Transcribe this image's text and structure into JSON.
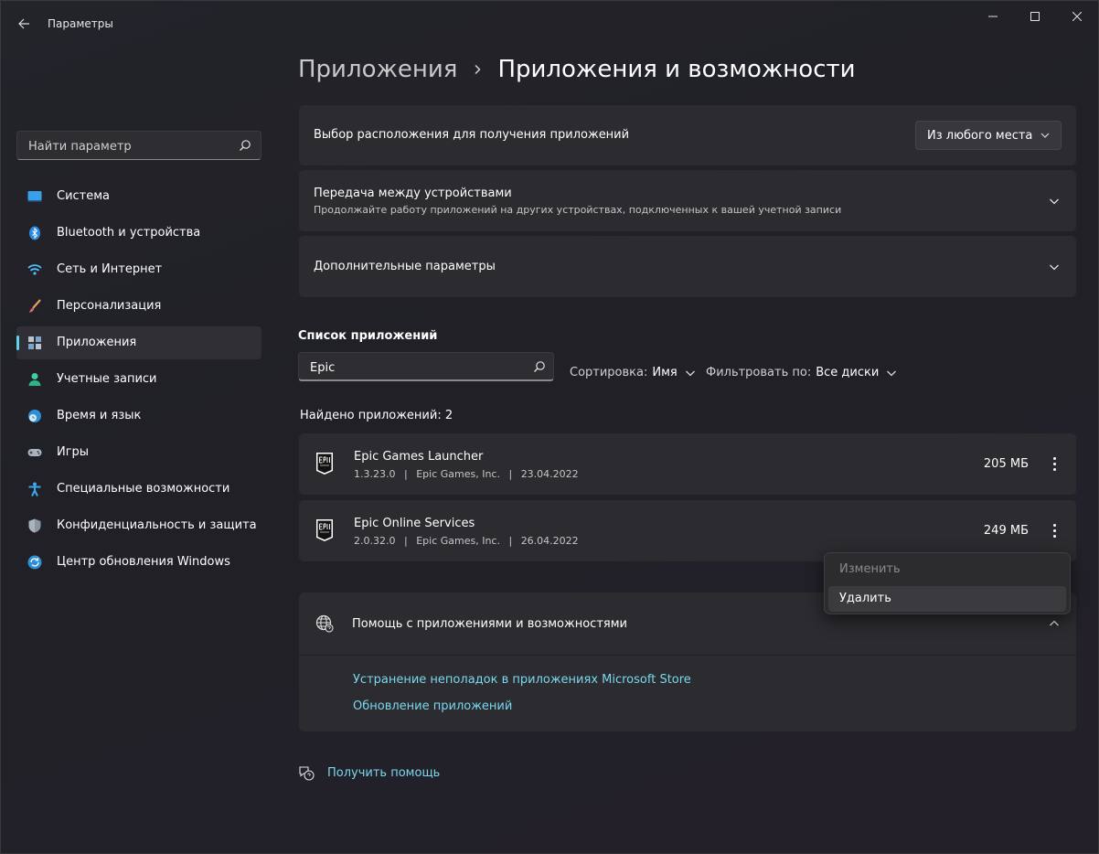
{
  "window": {
    "title": "Параметры",
    "controls": [
      "minimize-icon",
      "maximize-icon",
      "close-icon"
    ]
  },
  "sidebar": {
    "search_placeholder": "Найти параметр",
    "items": [
      {
        "label": "Система",
        "icon": "system-icon",
        "active": false
      },
      {
        "label": "Bluetooth и устройства",
        "icon": "bluetooth-icon",
        "active": false
      },
      {
        "label": "Сеть и Интернет",
        "icon": "wifi-icon",
        "active": false
      },
      {
        "label": "Персонализация",
        "icon": "brush-icon",
        "active": false
      },
      {
        "label": "Приложения",
        "icon": "apps-icon",
        "active": true
      },
      {
        "label": "Учетные записи",
        "icon": "user-icon",
        "active": false
      },
      {
        "label": "Время и язык",
        "icon": "clock-globe-icon",
        "active": false
      },
      {
        "label": "Игры",
        "icon": "gamepad-icon",
        "active": false
      },
      {
        "label": "Специальные возможности",
        "icon": "accessibility-icon",
        "active": false
      },
      {
        "label": "Конфиденциальность и защита",
        "icon": "shield-icon",
        "active": false
      },
      {
        "label": "Центр обновления Windows",
        "icon": "update-icon",
        "active": false
      }
    ]
  },
  "breadcrumb": {
    "parent": "Приложения",
    "current": "Приложения и возможности"
  },
  "settings": {
    "install_location": {
      "label": "Выбор расположения для получения приложений",
      "value": "Из любого места"
    },
    "cross_device": {
      "label": "Передача между устройствами",
      "description": "Продолжайте работу приложений на других устройствах, подключенных к вашей учетной записи"
    },
    "advanced": {
      "label": "Дополнительные параметры"
    }
  },
  "app_list": {
    "title": "Список приложений",
    "search_value": "Epic",
    "sort_label": "Сортировка:",
    "sort_value": "Имя",
    "filter_label": "Фильтровать по:",
    "filter_value": "Все диски",
    "found_text": "Найдено приложений: 2",
    "apps": [
      {
        "name": "Epic Games Launcher",
        "version": "1.3.23.0",
        "publisher": "Epic Games, Inc.",
        "date": "23.04.2022",
        "size": "205 МБ"
      },
      {
        "name": "Epic Online Services",
        "version": "2.0.32.0",
        "publisher": "Epic Games, Inc.",
        "date": "26.04.2022",
        "size": "249 МБ"
      }
    ],
    "separator": "|"
  },
  "context_menu": {
    "items": [
      {
        "label": "Изменить",
        "disabled": true
      },
      {
        "label": "Удалить",
        "disabled": false,
        "hover": true
      }
    ]
  },
  "help": {
    "title": "Помощь с приложениями и возможностями",
    "links": [
      "Устранение неполадок в приложениях Microsoft Store",
      "Обновление приложений"
    ]
  },
  "get_help": {
    "label": "Получить помощь"
  },
  "colors": {
    "accent": "#79d8ee",
    "indicator": "#5fd3e8",
    "card": "#2b2b30"
  }
}
